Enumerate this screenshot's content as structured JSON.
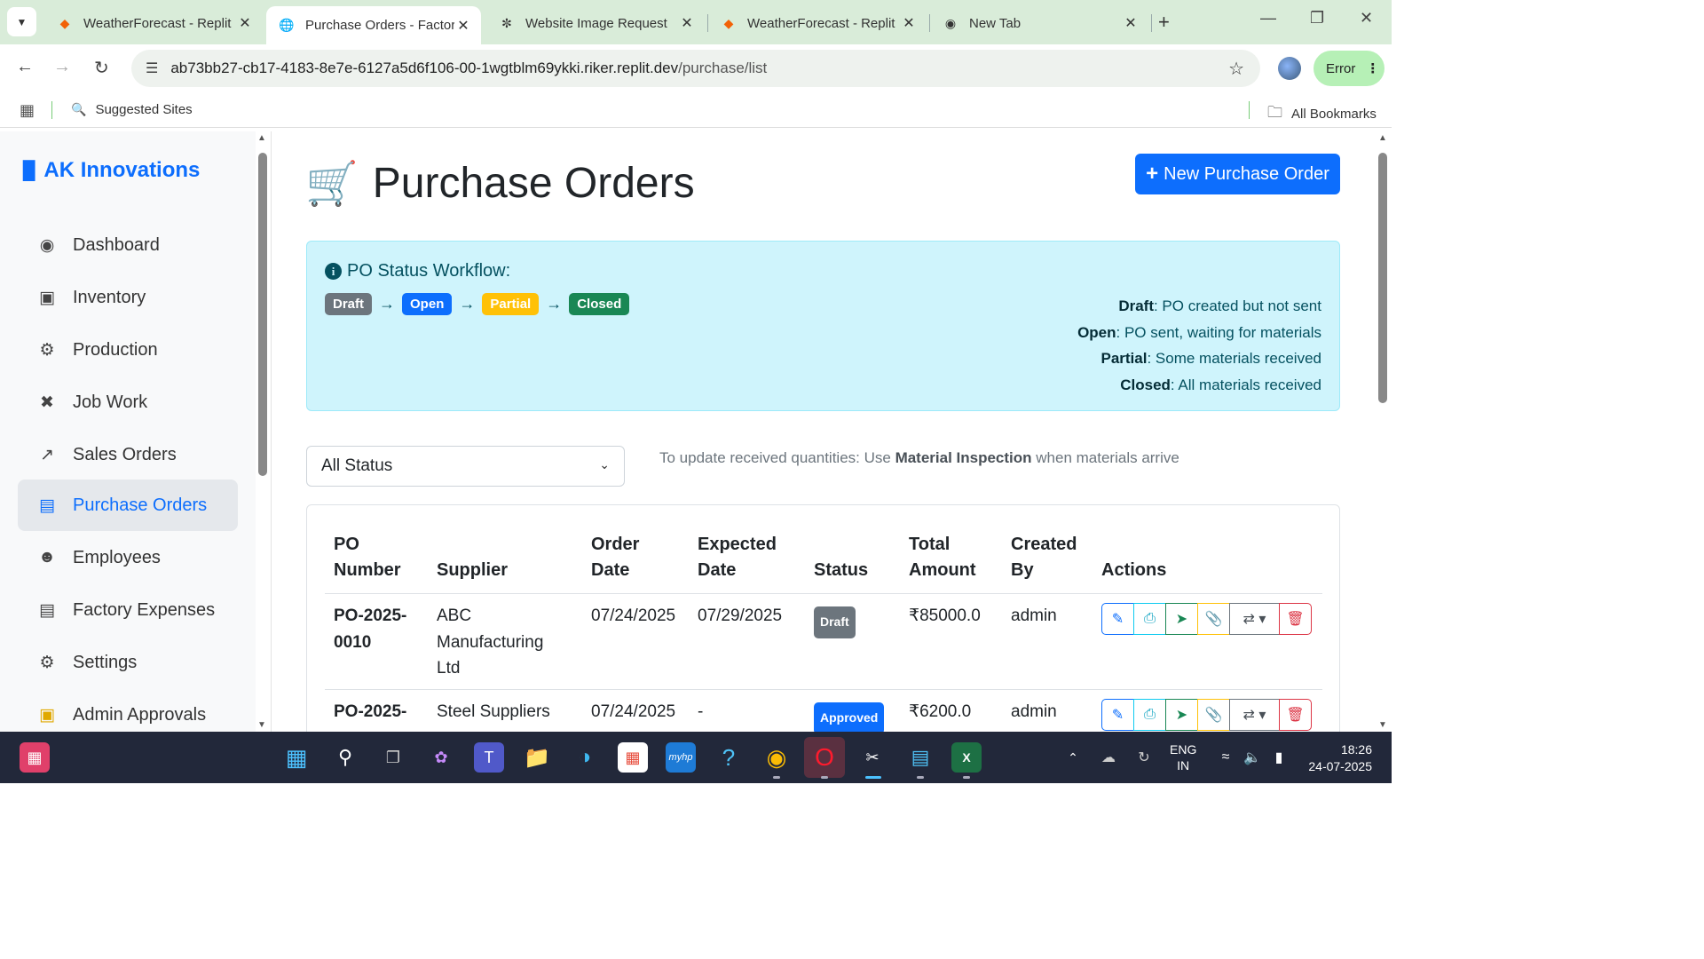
{
  "browser": {
    "tabs": [
      {
        "title": "WeatherForecast - Replit",
        "icon": "replit-icon"
      },
      {
        "title": "Purchase Orders - Factory",
        "icon": "globe-icon",
        "active": true
      },
      {
        "title": "Website Image Request",
        "icon": "openai-icon"
      },
      {
        "title": "WeatherForecast - Replit",
        "icon": "replit-icon"
      },
      {
        "title": "New Tab",
        "icon": "chrome-icon"
      }
    ],
    "url_host": "ab73bb27-cb17-4183-8e7e-6127a5d6f106-00-1wgtblm69ykki.riker.replit.dev",
    "url_path": "/purchase/list",
    "error_label": "Error",
    "suggested_sites": "Suggested Sites",
    "all_bookmarks": "All Bookmarks"
  },
  "sidebar": {
    "brand": "AK Innovations",
    "items": [
      {
        "label": "Dashboard",
        "icon": "palette-icon"
      },
      {
        "label": "Inventory",
        "icon": "boxes-icon"
      },
      {
        "label": "Production",
        "icon": "cogs-icon"
      },
      {
        "label": "Job Work",
        "icon": "tools-icon"
      },
      {
        "label": "Sales Orders",
        "icon": "chart-line-icon"
      },
      {
        "label": "Purchase Orders",
        "icon": "file-invoice-icon",
        "active": true
      },
      {
        "label": "Employees",
        "icon": "users-icon"
      },
      {
        "label": "Factory Expenses",
        "icon": "receipt-icon"
      },
      {
        "label": "Settings",
        "icon": "gear-icon"
      },
      {
        "label": "Admin Approvals",
        "icon": "clipboard-check-icon"
      }
    ]
  },
  "page": {
    "title": "Purchase Orders",
    "new_button": "New Purchase Order",
    "workflow": {
      "title": "PO Status Workflow:",
      "steps": [
        "Draft",
        "Open",
        "Partial",
        "Closed"
      ],
      "legend": [
        {
          "term": "Draft",
          "desc": ": PO created but not sent"
        },
        {
          "term": "Open",
          "desc": ": PO sent, waiting for materials"
        },
        {
          "term": "Partial",
          "desc": ": Some materials received"
        },
        {
          "term": "Closed",
          "desc": ": All materials received"
        }
      ]
    },
    "filter": {
      "selected": "All Status"
    },
    "hint": {
      "pre": "To update received quantities: Use ",
      "bold": "Material Inspection",
      "post": " when materials arrive"
    }
  },
  "table": {
    "headers": {
      "po_number": [
        "PO",
        "Number"
      ],
      "supplier": "Supplier",
      "order_date": [
        "Order",
        "Date"
      ],
      "expected_date": [
        "Expected",
        "Date"
      ],
      "status": "Status",
      "total_amount": [
        "Total",
        "Amount"
      ],
      "created_by": [
        "Created",
        "By"
      ],
      "actions": "Actions"
    },
    "rows": [
      {
        "po_number": [
          "PO-2025-",
          "0010"
        ],
        "supplier": [
          "ABC",
          "Manufacturing",
          "Ltd"
        ],
        "order_date": "07/24/2025",
        "expected_date": "07/29/2025",
        "status": "Draft",
        "status_color": "#6c757d",
        "total_amount": "₹85000.0",
        "created_by": "admin"
      },
      {
        "po_number": [
          "PO-2025-",
          ""
        ],
        "supplier": [
          "Steel Suppliers",
          "",
          ""
        ],
        "order_date": "07/24/2025",
        "expected_date": "-",
        "status": "Approved",
        "status_color": "#0d6efd",
        "total_amount": "₹6200.0",
        "created_by": "admin"
      }
    ]
  },
  "taskbar": {
    "lang": [
      "ENG",
      "IN"
    ],
    "time": "18:26",
    "date": "24-07-2025"
  }
}
